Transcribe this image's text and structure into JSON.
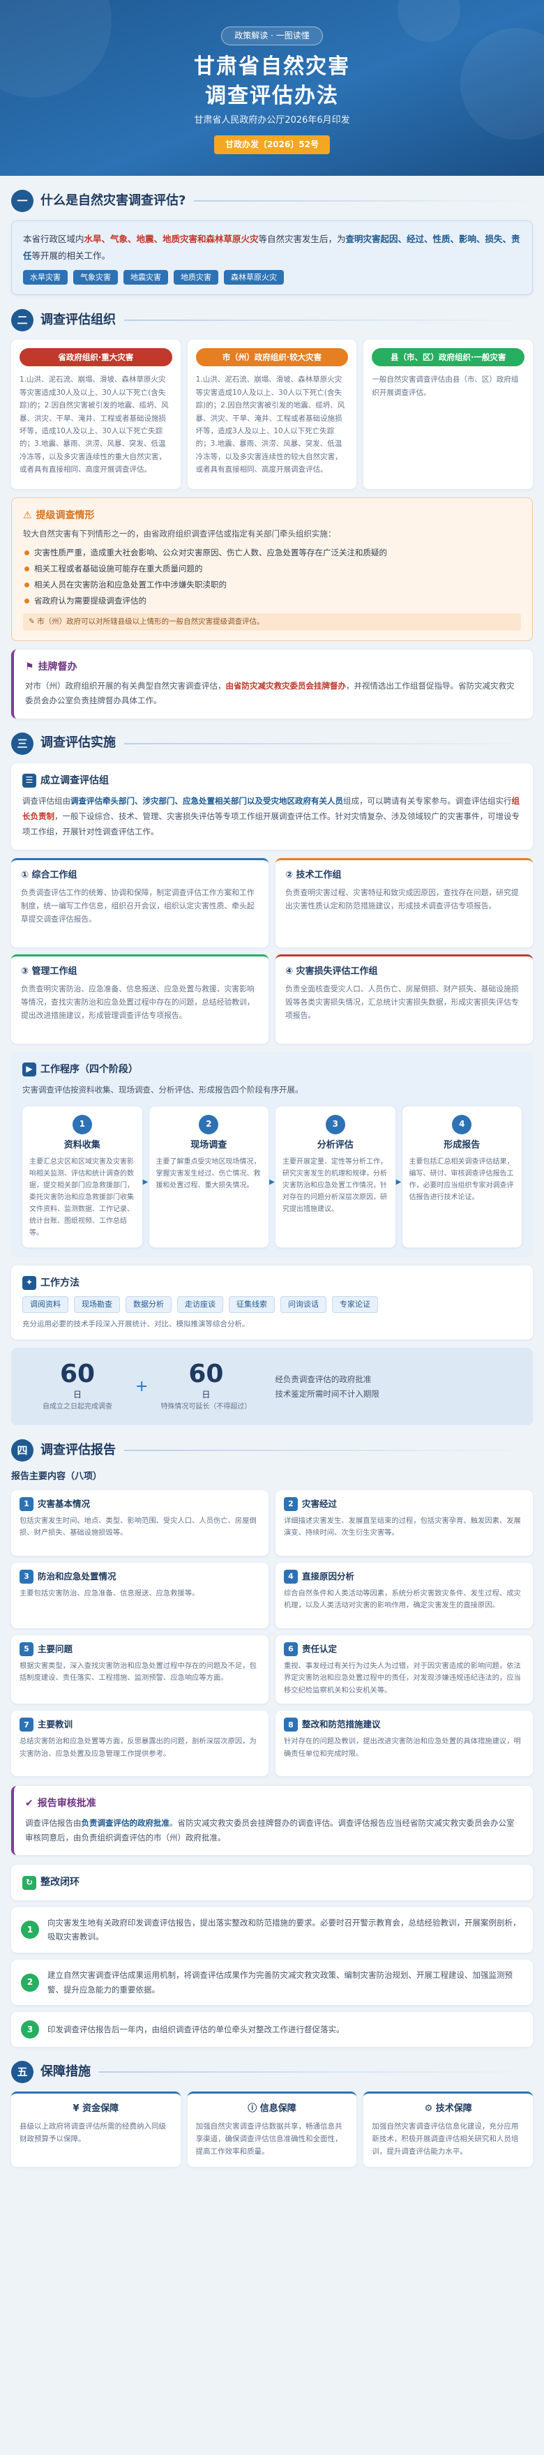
{
  "header": {
    "tag": "政策解读 · 一图读懂",
    "title_line1": "甘肃省自然灾害",
    "title_line2": "调查评估办法",
    "issuer": "甘肃省人民政府办公厅2026年6月印发",
    "doc_no": "甘政办发〔2026〕52号"
  },
  "s1": {
    "num": "一",
    "title": "什么是自然灾害调查评估?",
    "text_a": "本省行政区域内",
    "text_hl": "水旱、气象、地震、地质灾害和森林草原火灾",
    "text_b": "等自然灾害发生后，为",
    "text_hl2": "查明灾害起因、经过、性质、影响、损失、责任",
    "text_c": "等开展的相关工作。",
    "tags": [
      "水旱灾害",
      "气象灾害",
      "地震灾害",
      "地质灾害",
      "森林草原火灾"
    ]
  },
  "s2": {
    "num": "二",
    "title": "调查评估组织",
    "cols": [
      {
        "pill": "省政府组织·重大灾害",
        "color": "#c0392b",
        "body": "1.山洪、泥石流、崩塌、滑坡、森林草原火灾等灾害造成30人及以上、30人以下死亡(含失踪)的；2.因自然灾害被引发的地震、缆坍、风暴、洪灾、干旱、淹井、工程或者基础设施损坏等，造成10人及以上、30人以下死亡失踪的；3.地震、暴雨、洪涝、风暴、突发、低温冷冻等，以及多灾害连续性的重大自然灾害，或者具有直接相同、高度开展调查评估。"
      },
      {
        "pill": "市（州）政府组织·较大灾害",
        "color": "#e67e22",
        "body": "1.山洪、泥石流、崩塌、滑坡、森林草原火灾等灾害造成10人及以上、30人以下死亡(含失踪)的；2.因自然灾害被引发的地震、缆坍、风暴、洪灾、干旱、淹井、工程或者基础设施损坏等，造成3人及以上、10人以下死亡失踪的；3.地震、暴雨、洪涝、风暴、突发、低温冷冻等，以及多灾害连续性的较大自然灾害，或者具有直接相同、高度开展调查评估。"
      },
      {
        "pill": "县（市、区）政府组织·一般灾害",
        "color": "#27ae60",
        "body": "一般自然灾害调查评估由县（市、区）政府组织开展调查评估。"
      }
    ],
    "warn": {
      "title": "提级调查情形",
      "intro": "较大自然灾害有下列情形之一的，由省政府组织调查评估或指定有关部门牵头组织实施：",
      "items": [
        "灾害性质严重，造成重大社会影响、公众对灾害原因、伤亡人数、应急处置等存在广泛关注和质疑的",
        "相关工程或者基础设施可能存在重大质量问题的",
        "相关人员在灾害防治和应急处置工作中涉嫌失职渎职的",
        "省政府认为需要提级调查评估的"
      ],
      "note": "市（州）政府可以对所辖县级以上情形的一般自然灾害提级调查评估。"
    },
    "supervise": {
      "title": "挂牌督办",
      "text_a": "对市（州）政府组织开展的有关典型自然灾害调查评估，",
      "text_hl": "由省防灾减灾救灾委员会挂牌督办",
      "text_b": "，并视情选出工作组督促指导。省防灾减灾救灾委员会办公室负责挂牌督办具体工作。"
    }
  },
  "s3": {
    "num": "三",
    "title": "调查评估实施",
    "team": {
      "title": "成立调查评估组",
      "text_a": "调查评估组由",
      "text_hl": "调查评估牵头部门、涉灾部门、应急处置相关部门以及受灾地区政府有关人员",
      "text_b": "组成，可以聘请有关专家参与。调查评估组实行",
      "text_hl2": "组长负责制",
      "text_c": "，一般下设综合、技术、管理、灾害损失评估等专项工作组开展调查评估工作。针对灾情复杂、涉及领域较广的灾害事件，可增设专项工作组，开展针对性调查评估工作。"
    },
    "groups": [
      {
        "title": "① 综合工作组",
        "text": "负责调查评估工作的统筹、协调和保障，制定调查评估工作方案和工作制度，统一编写工作信息，组织召开会议，组织认定灾害性质、牵头起草提交调查评估报告。"
      },
      {
        "title": "② 技术工作组",
        "text": "负责查明灾害过程、灾害特征和致灾成因原因，查找存在问题，研究提出灾害性质认定和防范措施建议，形成技术调查评估专项报告。"
      },
      {
        "title": "③ 管理工作组",
        "text": "负责查明灾害防治、应急准备、信息报送、应急处置与救援、灾害影响等情况，查找灾害防治和应急处置过程中存在的问题，总结经验教训，提出改进措施建议，形成管理调查评估专项报告。"
      },
      {
        "title": "④ 灾害损失评估工作组",
        "text": "负责全面核查受灾人口、人员伤亡、房屋倒损、财产损失、基础设施损毁等各类灾害损失情况，汇总统计灾害损失数据，形成灾害损失评估专项报告。"
      }
    ],
    "proc": {
      "title": "工作程序（四个阶段）",
      "intro": "灾害调查评估按资料收集、现场调查、分析评估、形成报告四个阶段有序开展。",
      "steps": [
        {
          "num": "1",
          "title": "资料收集",
          "text": "主要汇总灾区和区域灾害及灾害影响相关监测、评估和统计调查的数据，提交相关部门应急救援部门，委托灾害防治和应急救援部门收集文件资料、监测数据、工作记录、统计台账、图纸视频、工作总结等。"
        },
        {
          "num": "2",
          "title": "现场调查",
          "text": "主要了解重点受灾地区现场情况，掌握灾害发生经过、伤亡情况、救援和处置过程、重大损失情况。"
        },
        {
          "num": "3",
          "title": "分析评估",
          "text": "主要开展定量、定性等分析工作，研究灾害发生的机理和规律，分析灾害防治和应急处置工作情况，针对存在的问题分析深层次原因，研究提出措施建议。"
        },
        {
          "num": "4",
          "title": "形成报告",
          "text": "主要包括汇总相关调查评估结果，编写、研讨、审核调查评估报告工作，必要时应当组织专家对调查评估报告进行技术论证。"
        }
      ]
    },
    "methods": {
      "title": "工作方法",
      "items": [
        "调阅资料",
        "现场勘查",
        "数据分析",
        "走访座谈",
        "征集线索",
        "问询谈话",
        "专家论证"
      ],
      "note": "充分运用必要的技术手段深入开展统计、对比、模拟推演等综合分析。"
    },
    "time": {
      "n1": "60",
      "u1": "日",
      "l1": "自成立之日起完成调查",
      "n2": "60",
      "u2": "日",
      "l2": "特殊情况可延长（不得超过）",
      "plus": "+",
      "desc1": "经负责调查评估的政府批准",
      "desc2": "技术鉴定所需时间不计入期限"
    }
  },
  "s4": {
    "num": "四",
    "title": "调查评估报告",
    "list_label": "报告主要内容（八项）",
    "items": [
      {
        "num": "1",
        "title": "灾害基本情况",
        "text": "包括灾害发生时间、地点、类型、影响范围、受灾人口、人员伤亡、房屋倒损、财产损失、基础设施损毁等。"
      },
      {
        "num": "2",
        "title": "灾害经过",
        "text": "详细描述灾害发生、发展直至结束的过程，包括灾害孕育、触发因素、发展演变、持续时间、次生衍生灾害等。"
      },
      {
        "num": "3",
        "title": "防治和应急处置情况",
        "text": "主要包括灾害防治、应急准备、信息报送、应急救援等。"
      },
      {
        "num": "4",
        "title": "直接原因分析",
        "text": "综合自然条件和人类活动等因素，系统分析灾害致灾条件、发生过程、成灾机理，以及人类活动对灾害的影响作用，确定灾害发生的直接原因。"
      },
      {
        "num": "5",
        "title": "主要问题",
        "text": "根据灾害类型，深入查找灾害防治和应急处置过程中存在的问题及不足，包括制度建设、责任落实、工程措施、监测预警、应急响应等方面。"
      },
      {
        "num": "6",
        "title": "责任认定",
        "text": "重视、事发经过有关行为过失人为过错，对于因灾害造成的影响问题，依法界定灾害防治和应急处置过程中的责任，对发现涉嫌违规违纪违法的，应当移交纪检监察机关和公安机关等。"
      },
      {
        "num": "7",
        "title": "主要教训",
        "text": "总结灾害防治和应急处置等方面，反思暴露出的问题，剖析深层次原因，为灾害防治、应急处置及应急管理工作提供参考。"
      },
      {
        "num": "8",
        "title": "整改和防范措施建议",
        "text": "针对存在的问题及教训，提出改进灾害防治和应急处置的具体措施建议，明确责任单位和完成时限。"
      }
    ],
    "approve": {
      "title": "报告审核批准",
      "text_a": "调查评估报告由",
      "text_hl": "负责调查评估的政府批准",
      "text_b": "。省防灾减灾救灾委员会挂牌督办的调查评估。调查评估报告应当经省防灾减灾救灾委员会办公室审核同意后，由负责组织调查评估的市（州）政府批准。"
    },
    "rect": {
      "title": "整改闭环",
      "items": [
        {
          "num": "1",
          "text": "向灾害发生地有关政府印发调查评估报告，提出落实整改和防范措施的要求。必要时召开警示教育会，总结经验教训，开展案例剖析，吸取灾害教训。"
        },
        {
          "num": "2",
          "text": "建立自然灾害调查评估成果运用机制，将调查评估成果作为完善防灾减灾救灾政策、编制灾害防治规划、开展工程建设、加强监测预警、提升应急能力的重要依据。"
        },
        {
          "num": "3",
          "text": "印发调查评估报告后一年内，由组织调查评估的单位牵头对整改工作进行督促落实。"
        }
      ]
    }
  },
  "s5": {
    "num": "五",
    "title": "保障措施",
    "cols": [
      {
        "title": "资金保障",
        "text": "县级以上政府将调查评估所需的经费纳入同级财政预算予以保障。"
      },
      {
        "title": "信息保障",
        "text": "加强自然灾害调查评估数据共享，畅通信息共享渠道，确保调查评估信息准确性和全面性，提高工作效率和质量。"
      },
      {
        "title": "技术保障",
        "text": "加强自然灾害调查评估信息化建设，充分应用新技术，积极开展调查评估相关研究和人员培训，提升调查评估能力水平。"
      }
    ]
  },
  "colors": {
    "primary": "#1f5a93",
    "accent": "#f5a623",
    "danger": "#c0392b",
    "warn": "#e67e22",
    "ok": "#27ae60",
    "purple": "#7d3c98"
  },
  "icons": {
    "team": "team-icon",
    "process": "process-icon",
    "method": "tool-icon",
    "approve": "approve-icon",
    "rectify": "loop-icon",
    "funds": "money-icon",
    "info": "info-icon",
    "tech": "tech-icon"
  }
}
